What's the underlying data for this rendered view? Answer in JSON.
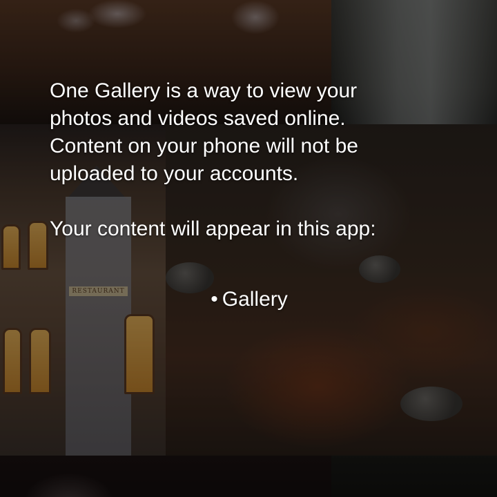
{
  "dialog": {
    "intro_text": "One Gallery is a way to view your photos and videos saved online. Content on your phone will not be uploaded to your accounts.",
    "intro_lines": [
      "One Gallery is a way to view your",
      "photos and videos saved online.",
      "Content on your phone will not be",
      "uploaded to your accounts."
    ],
    "apps_heading": "Your content will appear in this app:",
    "apps": [
      {
        "bullet": "•",
        "label": "Gallery"
      }
    ]
  },
  "background": {
    "tiles": [
      "flowers",
      "waterfall",
      "village",
      "autumn-leaves",
      "fireworks",
      "dark-landscape"
    ],
    "scrim_color": "#000000"
  },
  "colors": {
    "text": "#ffffff"
  }
}
